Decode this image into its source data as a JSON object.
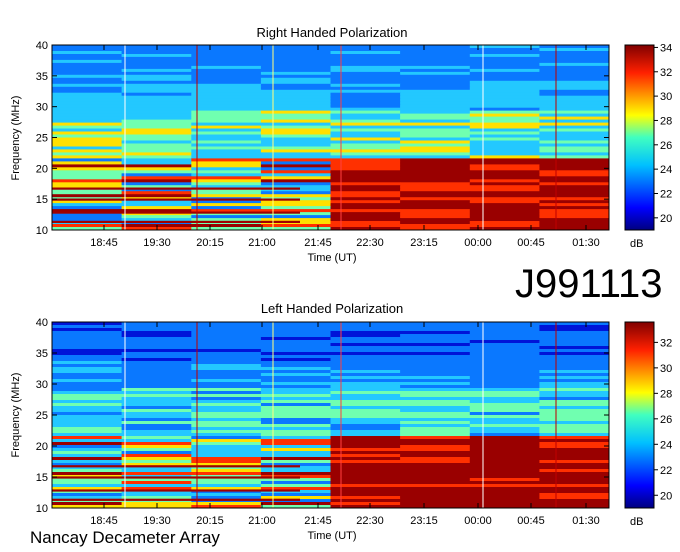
{
  "observation_id": "J991113",
  "instrument": "Nancay Decameter Array",
  "colorbar_unit": "dB",
  "colors": {
    "background": "#00009a",
    "low": "#0a1ab8",
    "mid": "#23c8ff",
    "high": "#ffe000",
    "max": "#9a0000"
  },
  "chart_data": [
    {
      "type": "heatmap",
      "title": "Right Handed Polarization",
      "xlabel": "Time (UT)",
      "ylabel": "Frequency (MHz)",
      "x_ticks": [
        "18:45",
        "19:30",
        "20:15",
        "21:00",
        "21:45",
        "22:30",
        "23:15",
        "00:00",
        "00:45",
        "01:30"
      ],
      "y_ticks": [
        10,
        15,
        20,
        25,
        30,
        35,
        40
      ],
      "ylim": [
        10,
        40
      ],
      "colorbar": {
        "ticks": [
          20,
          22,
          24,
          26,
          28,
          30,
          32,
          34
        ],
        "range": [
          19,
          34
        ],
        "unit": "dB"
      }
    },
    {
      "type": "heatmap",
      "title": "Left Handed Polarization",
      "xlabel": "Time (UT)",
      "ylabel": "Frequency (MHz)",
      "x_ticks": [
        "18:45",
        "19:30",
        "20:15",
        "21:00",
        "21:45",
        "22:30",
        "23:15",
        "00:00",
        "00:45",
        "01:30"
      ],
      "y_ticks": [
        10,
        15,
        20,
        25,
        30,
        35,
        40
      ],
      "ylim": [
        10,
        40
      ],
      "colorbar": {
        "ticks": [
          20,
          22,
          24,
          26,
          28,
          30,
          32
        ],
        "range": [
          19,
          33.5
        ],
        "unit": "dB"
      }
    }
  ]
}
